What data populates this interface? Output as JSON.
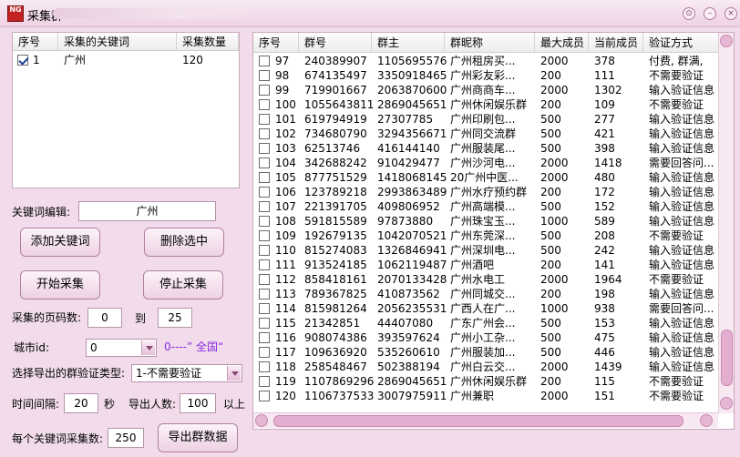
{
  "window": {
    "title": "采集群",
    "icon_text": "NG"
  },
  "keyword_list": {
    "headers": [
      "序号",
      "采集的关键词",
      "采集数量"
    ],
    "rows": [
      {
        "index": "1",
        "keyword": "广州",
        "count": "120",
        "checked": true
      }
    ]
  },
  "form": {
    "keyword_edit_label": "关键词编辑:",
    "keyword_edit_value": "广州",
    "add_keyword_button": "添加关键词",
    "delete_selected_button": "删除选中",
    "start_button": "开始采集",
    "stop_button": "停止采集",
    "page_range_label": "采集的页码数:",
    "page_from": "0",
    "page_to_label": "到",
    "page_to": "25",
    "city_label": "城市id:",
    "city_value": "0",
    "city_hint": "0----” 全国“",
    "verify_type_label": "选择导出的群验证类型:",
    "verify_type_value": "1-不需要验证",
    "interval_label": "时间间隔:",
    "interval_value": "20",
    "interval_unit": "秒",
    "export_count_label": "导出人数:",
    "export_count_value": "100",
    "export_count_suffix": "以上",
    "per_keyword_label": "每个关键词采集数:",
    "per_keyword_value": "250",
    "export_button": "导出群数据"
  },
  "groups_table": {
    "headers": [
      "序号",
      "群号",
      "群主",
      "群昵称",
      "最大成员",
      "当前成员",
      "验证方式"
    ],
    "rows": [
      [
        "97",
        "240389907",
        "1105695576",
        "广州租房买...",
        "2000",
        "378",
        "付费, 群满,"
      ],
      [
        "98",
        "674135497",
        "3350918465",
        "广州彩友彩...",
        "200",
        "111",
        "不需要验证"
      ],
      [
        "99",
        "719901667",
        "2063870600",
        "广州商商车...",
        "2000",
        "1302",
        "输入验证信息"
      ],
      [
        "100",
        "1055643811",
        "2869045651",
        "广州休闲娱乐群",
        "200",
        "109",
        "不需要验证"
      ],
      [
        "101",
        "619794919",
        "27307785",
        "广州印刷包...",
        "500",
        "277",
        "输入验证信息"
      ],
      [
        "102",
        "734680790",
        "3294356671",
        "广州同交流群",
        "500",
        "421",
        "输入验证信息"
      ],
      [
        "103",
        "62513746",
        "416144140",
        "广州服装尾...",
        "500",
        "398",
        "输入验证信息"
      ],
      [
        "104",
        "342688242",
        "910429477",
        "广州沙河电...",
        "2000",
        "1418",
        "需要回答问..."
      ],
      [
        "105",
        "877751529",
        "1418068145",
        "20广州中医...",
        "2000",
        "480",
        "输入验证信息"
      ],
      [
        "106",
        "123789218",
        "2993863489",
        "广州水疗预约群",
        "200",
        "172",
        "输入验证信息"
      ],
      [
        "107",
        "221391705",
        "409806952",
        "广州高端模...",
        "500",
        "152",
        "输入验证信息"
      ],
      [
        "108",
        "591815589",
        "97873880",
        "广州珠宝玉...",
        "1000",
        "589",
        "输入验证信息"
      ],
      [
        "109",
        "192679135",
        "1042070521",
        "广州东莞深...",
        "500",
        "208",
        "不需要验证"
      ],
      [
        "110",
        "815274083",
        "1326846941",
        "广州深圳电...",
        "500",
        "242",
        "输入验证信息"
      ],
      [
        "111",
        "913524185",
        "1062119487",
        "广州酒吧",
        "200",
        "141",
        "输入验证信息"
      ],
      [
        "112",
        "858418161",
        "2070133428",
        "广州水电工",
        "2000",
        "1964",
        "不需要验证"
      ],
      [
        "113",
        "789367825",
        "410873562",
        "广州同城交...",
        "200",
        "198",
        "输入验证信息"
      ],
      [
        "114",
        "815981264",
        "2056235531",
        "广西人在广...",
        "1000",
        "938",
        "需要回答问..."
      ],
      [
        "115",
        "21342851",
        "44407080",
        "广东广州会...",
        "500",
        "153",
        "输入验证信息"
      ],
      [
        "116",
        "908074386",
        "393597624",
        "广州小工杂...",
        "500",
        "475",
        "输入验证信息"
      ],
      [
        "117",
        "109636920",
        "535260610",
        "广州服装加...",
        "500",
        "446",
        "输入验证信息"
      ],
      [
        "118",
        "258548467",
        "502388194",
        "广州白云交...",
        "2000",
        "1439",
        "输入验证信息"
      ],
      [
        "119",
        "1107869296",
        "2869045651",
        "广州休闲娱乐群",
        "200",
        "115",
        "不需要验证"
      ],
      [
        "120",
        "1106737533",
        "3007975911",
        "广州兼职",
        "2000",
        "151",
        "不需要验证"
      ]
    ]
  },
  "colors": {
    "accent": "#e4aed0",
    "background": "#f2dceb",
    "hint": "#8a2be2"
  }
}
